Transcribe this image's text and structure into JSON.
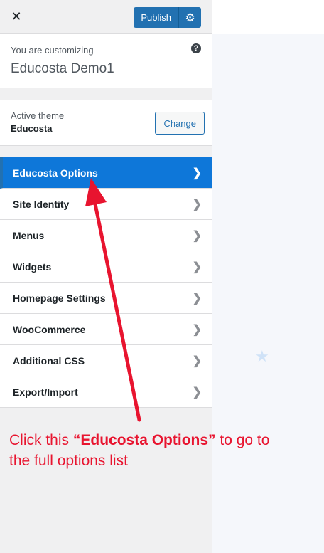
{
  "header": {
    "close_icon": "close-icon",
    "publish_label": "Publish",
    "settings_icon": "gear-icon"
  },
  "info": {
    "label": "You are customizing",
    "site_title": "Educosta Demo1",
    "help_icon": "question-icon"
  },
  "theme": {
    "label": "Active theme",
    "name": "Educosta",
    "change_label": "Change"
  },
  "menu": {
    "items": [
      {
        "label": "Educosta Options"
      },
      {
        "label": "Site Identity"
      },
      {
        "label": "Menus"
      },
      {
        "label": "Widgets"
      },
      {
        "label": "Homepage Settings"
      },
      {
        "label": "WooCommerce"
      },
      {
        "label": "Additional CSS"
      },
      {
        "label": "Export/Import"
      }
    ]
  },
  "annotation": {
    "prefix": "Click this ",
    "highlight": "“Educosta Options”",
    "suffix": " to go to the full options list"
  },
  "colors": {
    "accent": "#2271b1",
    "active_item": "#0e77d9",
    "annotation": "#e8142f"
  }
}
